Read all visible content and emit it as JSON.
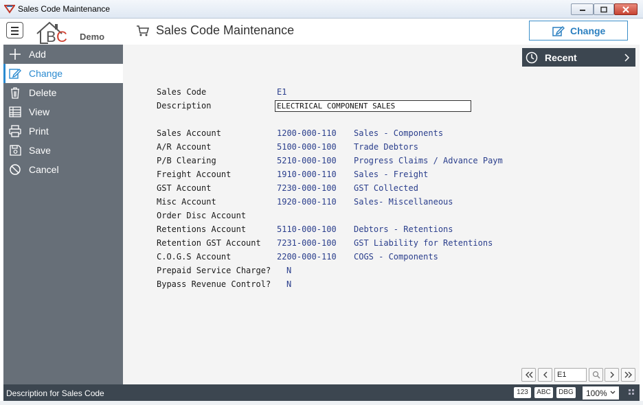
{
  "window": {
    "title": "Sales Code Maintenance"
  },
  "header": {
    "logo_text": "BC",
    "logo_sub": "Demo",
    "page_title": "Sales Code Maintenance",
    "action_button": "Change"
  },
  "sidebar": {
    "items": [
      {
        "label": "Add",
        "icon": "plus-icon"
      },
      {
        "label": "Change",
        "icon": "edit-icon",
        "active": true
      },
      {
        "label": "Delete",
        "icon": "trash-icon"
      },
      {
        "label": "View",
        "icon": "table-icon"
      },
      {
        "label": "Print",
        "icon": "printer-icon"
      },
      {
        "label": "Save",
        "icon": "save-icon"
      },
      {
        "label": "Cancel",
        "icon": "cancel-icon"
      }
    ]
  },
  "recent": {
    "label": "Recent"
  },
  "form": {
    "sales_code_label": "Sales Code",
    "sales_code_value": "E1",
    "description_label": "Description",
    "description_value": "ELECTRICAL COMPONENT SALES",
    "accounts": [
      {
        "label": "Sales Account",
        "code": "1200-000-110",
        "desc": "Sales - Components"
      },
      {
        "label": "A/R Account",
        "code": "5100-000-100",
        "desc": "Trade Debtors"
      },
      {
        "label": "P/B Clearing",
        "code": "5210-000-100",
        "desc": "Progress Claims / Advance Paym"
      },
      {
        "label": "Freight Account",
        "code": "1910-000-110",
        "desc": "Sales - Freight"
      },
      {
        "label": "GST Account",
        "code": "7230-000-100",
        "desc": "GST Collected"
      },
      {
        "label": "Misc Account",
        "code": "1920-000-110",
        "desc": "Sales- Miscellaneous"
      },
      {
        "label": "Order Disc Account",
        "code": "",
        "desc": ""
      },
      {
        "label": "Retentions Account",
        "code": "5110-000-100",
        "desc": "Debtors - Retentions"
      },
      {
        "label": "Retention GST Account",
        "code": "7231-000-100",
        "desc": "GST Liability for Retentions"
      },
      {
        "label": "C.O.G.S Account",
        "code": "2200-000-110",
        "desc": "COGS - Components"
      }
    ],
    "prepaid_label": "Prepaid Service Charge?",
    "prepaid_value": "N",
    "bypass_label": "Bypass Revenue Control?",
    "bypass_value": "N"
  },
  "navigator": {
    "record_value": "E1"
  },
  "statusbar": {
    "text": "Description for Sales Code",
    "btn_123": "123",
    "btn_abc": "ABC",
    "btn_dbg": "DBG",
    "zoom": "100%"
  },
  "colors": {
    "accent": "#2a8ad0",
    "sidebar_bg": "#676f78",
    "dark_bar": "#3c4650",
    "value_text": "#2a3e8c"
  }
}
